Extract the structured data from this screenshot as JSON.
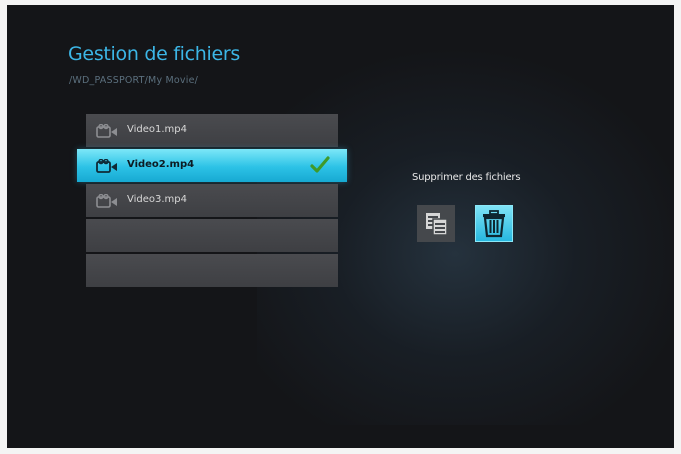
{
  "screen": {
    "title": "Gestion de fichiers",
    "path": "/WD_PASSPORT/My Movie/"
  },
  "files": [
    {
      "name": "Video1.mp4",
      "icon": "video-camera-icon",
      "selected": false
    },
    {
      "name": "Video2.mp4",
      "icon": "video-camera-icon",
      "selected": true,
      "checked": true
    },
    {
      "name": "Video3.mp4",
      "icon": "video-camera-icon",
      "selected": false
    },
    {
      "name": "",
      "selected": false
    },
    {
      "name": "",
      "selected": false
    }
  ],
  "actions": {
    "label": "Supprimer des fichiers",
    "buttons": [
      {
        "icon": "copy-files-icon",
        "selected": false
      },
      {
        "icon": "trash-icon",
        "selected": true
      }
    ]
  },
  "colors": {
    "accent": "#3cb6e6",
    "selection": "#2cc2e6",
    "check": "#3f9a2a",
    "background": "#141518"
  }
}
